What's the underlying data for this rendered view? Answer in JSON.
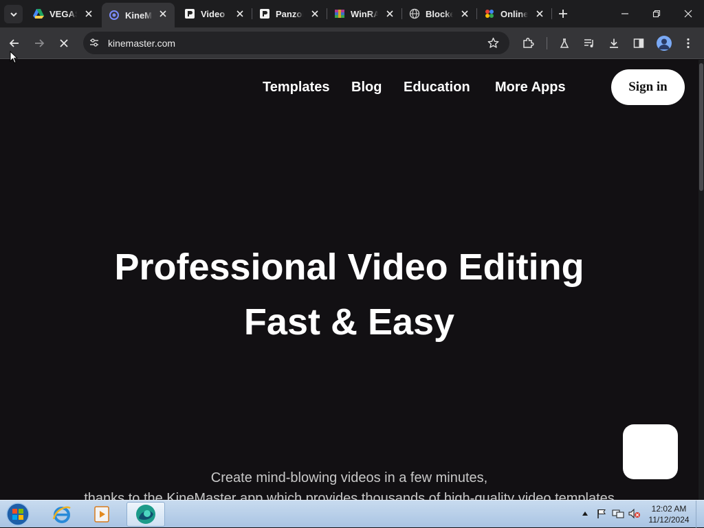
{
  "browser": {
    "tabs": [
      {
        "title": "VEGAS",
        "icon": "google-drive-icon"
      },
      {
        "title": "KineMaster",
        "icon": "kinemaster-icon",
        "active": true
      },
      {
        "title": "Video Editor",
        "icon": "p-icon"
      },
      {
        "title": "Panzoid",
        "icon": "p-icon"
      },
      {
        "title": "WinRAR",
        "icon": "winrar-icon"
      },
      {
        "title": "Blocked",
        "icon": "globe-icon"
      },
      {
        "title": "Online",
        "icon": "colorful-dots-icon"
      }
    ],
    "address": "kinemaster.com"
  },
  "page": {
    "nav": [
      "Templates",
      "Blog",
      "Education",
      "More Apps"
    ],
    "signin": "Sign in",
    "hero_line1": "Professional Video Editing",
    "hero_line2": "Fast & Easy",
    "sub_line1": "Create mind-blowing videos in a few minutes,",
    "sub_line2": "thanks to the KineMaster app which provides thousands of high-quality video templates"
  },
  "taskbar": {
    "time": "12:02 AM",
    "date": "11/12/2024"
  },
  "colors": {
    "page_bg": "#121013",
    "tab_strip": "#1d1d1f",
    "toolbar": "#353538"
  }
}
